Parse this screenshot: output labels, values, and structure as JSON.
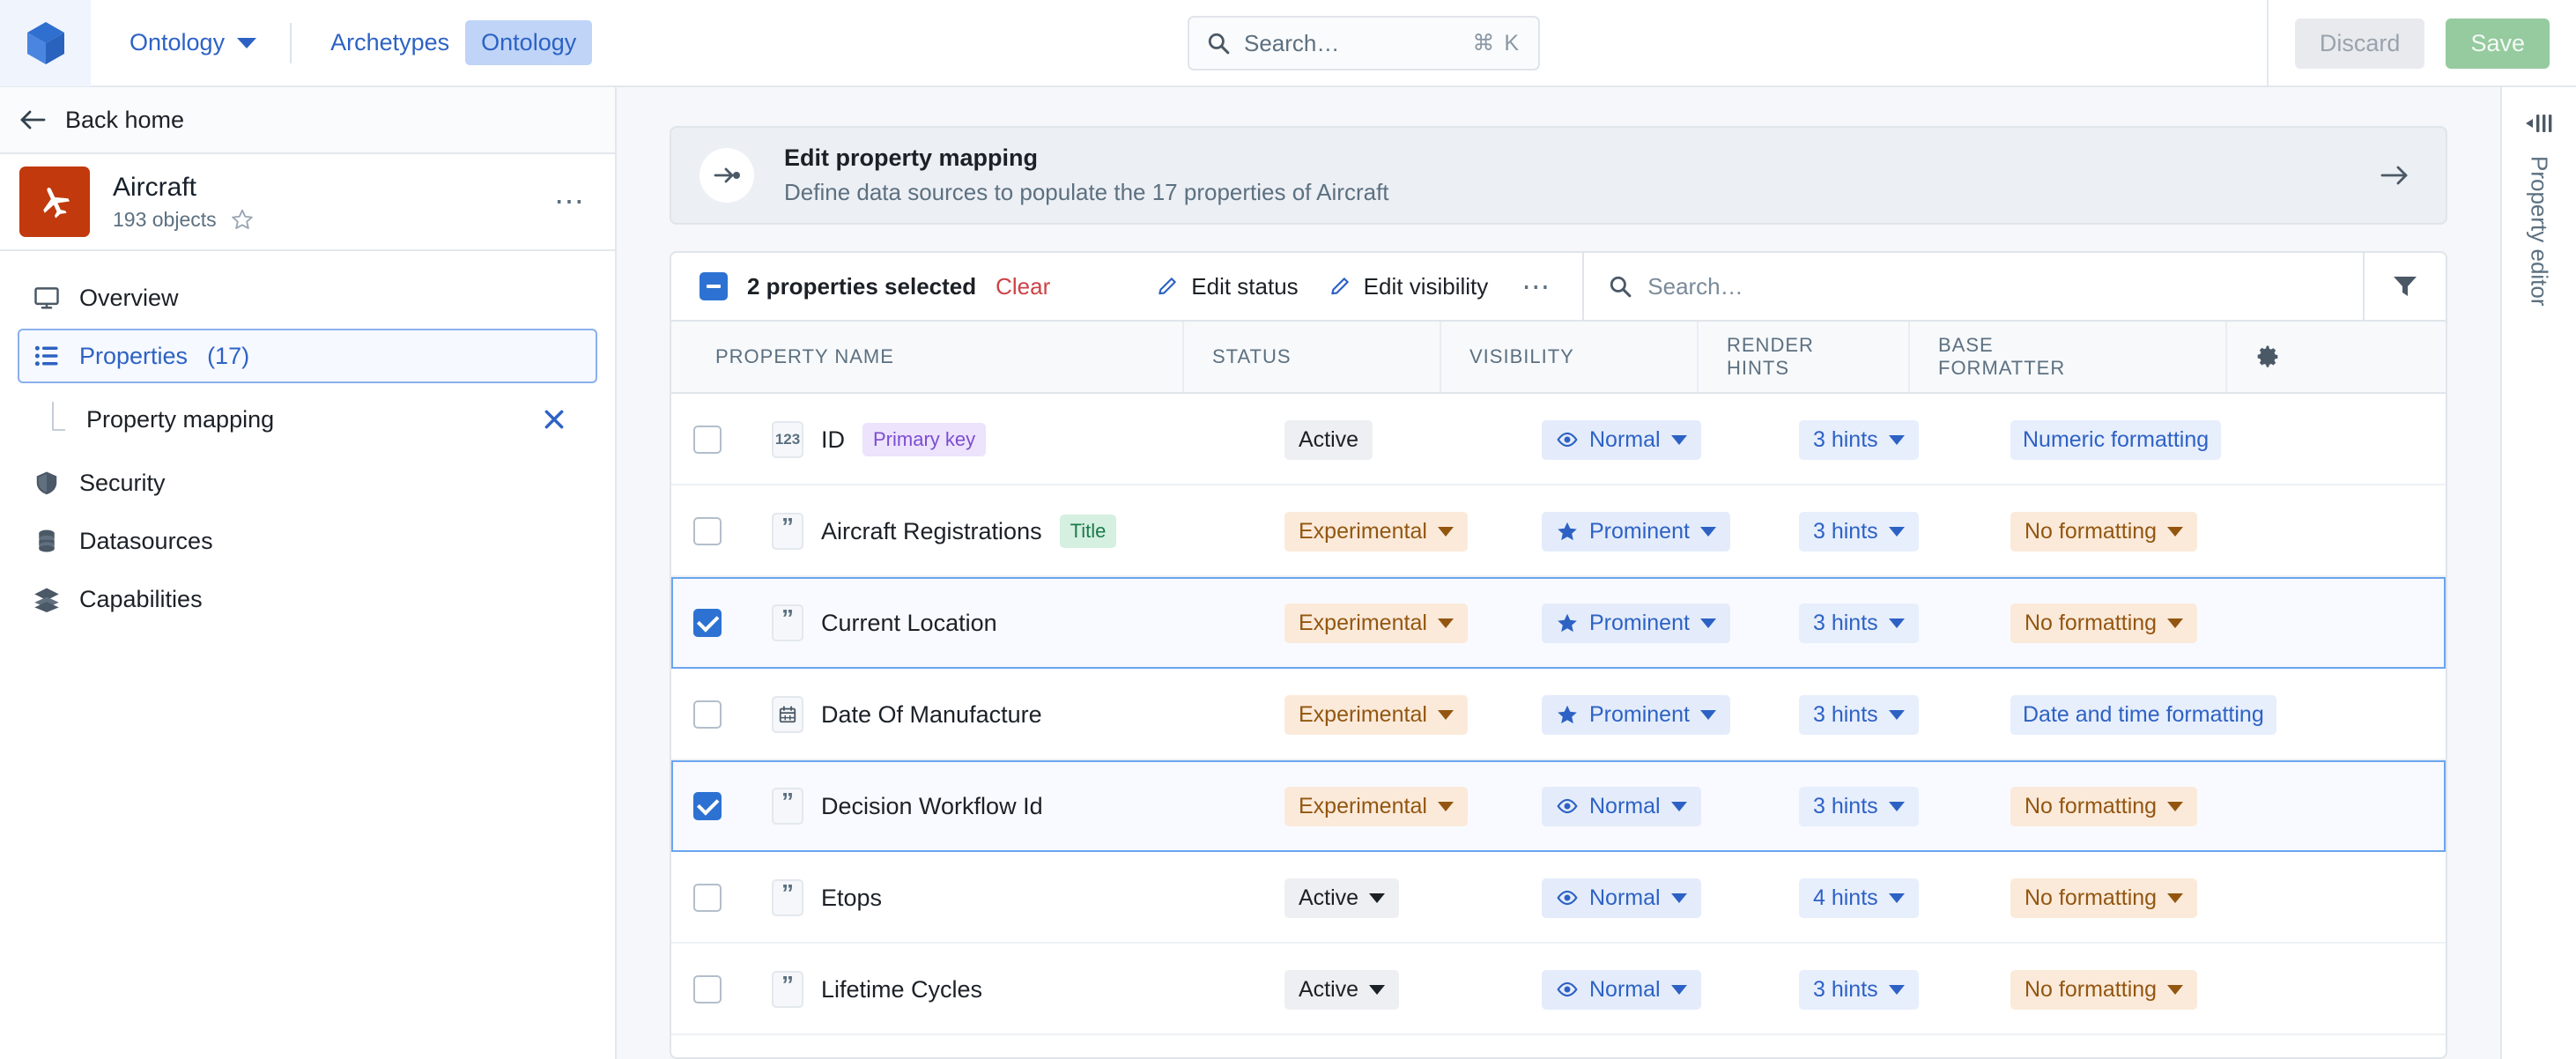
{
  "topbar": {
    "logo_icon": "cube-logo-icon",
    "workspace_dropdown": "Ontology",
    "tabs": [
      {
        "label": "Archetypes",
        "active": false
      },
      {
        "label": "Ontology",
        "active": true
      }
    ],
    "search": {
      "placeholder": "Search…",
      "shortcut": "⌘ K",
      "icon": "search-icon"
    },
    "discard_label": "Discard",
    "save_label": "Save"
  },
  "sidebar": {
    "back_label": "Back home",
    "object": {
      "title": "Aircraft",
      "subtitle": "193 objects",
      "icon": "airplane-icon",
      "icon_color": "#c1390c",
      "star_icon": "star-outline-icon",
      "overflow_icon": "more-options-icon"
    },
    "items": [
      {
        "label": "Overview",
        "icon": "desktop-icon",
        "selected": false
      },
      {
        "label": "Properties",
        "count": "(17)",
        "icon": "properties-list-icon",
        "selected": true
      },
      {
        "label": "Security",
        "icon": "shield-icon",
        "selected": false
      },
      {
        "label": "Datasources",
        "icon": "database-icon",
        "selected": false
      },
      {
        "label": "Capabilities",
        "icon": "layers-icon",
        "selected": false
      }
    ],
    "sub_item": {
      "label": "Property mapping",
      "close_icon": "close-icon"
    }
  },
  "banner": {
    "icon": "arrow-to-dot-icon",
    "title": "Edit property mapping",
    "subtitle": "Define data sources to populate the 17 properties of Aircraft",
    "action_icon": "arrow-right-icon"
  },
  "toolbar": {
    "selection_checkbox_state": "indeterminate",
    "selected_text": "2 properties selected",
    "clear_label": "Clear",
    "clear_color": "#cd4246",
    "edit_status_label": "Edit status",
    "edit_visibility_label": "Edit visibility",
    "overflow_label": "•••",
    "search_placeholder": "Search…",
    "filter_icon": "filter-funnel-icon",
    "settings_icon": "gear-icon"
  },
  "table": {
    "columns": [
      {
        "label": "PROPERTY NAME"
      },
      {
        "label": "STATUS"
      },
      {
        "label": "VISIBILITY"
      },
      {
        "label": "RENDER HINTS",
        "line1": "RENDER",
        "line2": "HINTS"
      },
      {
        "label": "BASE FORMATTER",
        "line1": "BASE",
        "line2": "FORMATTER"
      }
    ],
    "rows": [
      {
        "selected": false,
        "type_icon": "numeric-type-icon",
        "type_glyph": "123",
        "name": "ID",
        "tag": "Primary key",
        "tag_style": "primary",
        "status": "Active",
        "status_style": "gray",
        "status_caret": false,
        "visibility": "Normal",
        "visibility_icon": "eye-icon",
        "visibility_style": "blue",
        "hints": "3 hints",
        "formatter": "Numeric formatting",
        "formatter_style": "link"
      },
      {
        "selected": false,
        "type_icon": "string-type-icon",
        "type_glyph": "”",
        "name": "Aircraft Registrations",
        "tag": "Title",
        "tag_style": "title",
        "status": "Experimental",
        "status_style": "orange",
        "status_caret": true,
        "visibility": "Prominent",
        "visibility_icon": "star-icon",
        "visibility_style": "blue",
        "hints": "3 hints",
        "formatter": "No formatting",
        "formatter_style": "orange"
      },
      {
        "selected": true,
        "type_icon": "string-type-icon",
        "type_glyph": "”",
        "name": "Current Location",
        "tag": null,
        "tag_style": null,
        "status": "Experimental",
        "status_style": "orange",
        "status_caret": true,
        "visibility": "Prominent",
        "visibility_icon": "star-icon",
        "visibility_style": "blue",
        "hints": "3 hints",
        "formatter": "No formatting",
        "formatter_style": "orange"
      },
      {
        "selected": false,
        "type_icon": "date-type-icon",
        "type_glyph": "",
        "name": "Date Of Manufacture",
        "tag": null,
        "tag_style": null,
        "status": "Experimental",
        "status_style": "orange",
        "status_caret": true,
        "visibility": "Prominent",
        "visibility_icon": "star-icon",
        "visibility_style": "blue",
        "hints": "3 hints",
        "formatter": "Date and time formatting",
        "formatter_style": "link"
      },
      {
        "selected": true,
        "type_icon": "string-type-icon",
        "type_glyph": "”",
        "name": "Decision Workflow Id",
        "tag": null,
        "tag_style": null,
        "status": "Experimental",
        "status_style": "orange",
        "status_caret": true,
        "visibility": "Normal",
        "visibility_icon": "eye-icon",
        "visibility_style": "blue",
        "hints": "3 hints",
        "formatter": "No formatting",
        "formatter_style": "orange"
      },
      {
        "selected": false,
        "type_icon": "string-type-icon",
        "type_glyph": "”",
        "name": "Etops",
        "tag": null,
        "tag_style": null,
        "status": "Active",
        "status_style": "gray",
        "status_caret": true,
        "visibility": "Normal",
        "visibility_icon": "eye-icon",
        "visibility_style": "blue",
        "hints": "4 hints",
        "formatter": "No formatting",
        "formatter_style": "orange"
      },
      {
        "selected": false,
        "type_icon": "string-type-icon",
        "type_glyph": "”",
        "name": "Lifetime Cycles",
        "tag": null,
        "tag_style": null,
        "status": "Active",
        "status_style": "gray",
        "status_caret": true,
        "visibility": "Normal",
        "visibility_icon": "eye-icon",
        "visibility_style": "blue",
        "hints": "3 hints",
        "formatter": "No formatting",
        "formatter_style": "orange"
      }
    ]
  },
  "rail": {
    "collapse_icon": "panel-collapse-icon",
    "label": "Property editor"
  }
}
